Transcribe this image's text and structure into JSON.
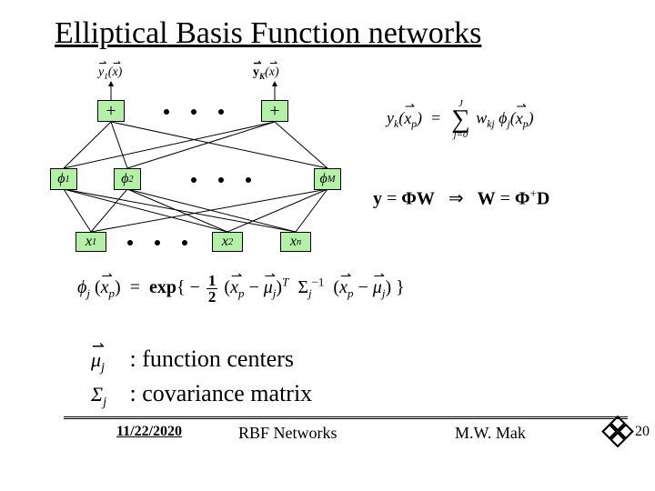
{
  "title": "Elliptical Basis Function networks",
  "outputs": {
    "first_label": "y₁(x⃗)",
    "last_label": "y_K(x⃗)",
    "symbol": "+"
  },
  "hidden": {
    "first": "ϕ₁",
    "second": "ϕ₂",
    "last": "ϕ_M"
  },
  "inputs": {
    "x1": "x₁",
    "x2": "x₂",
    "xn": "xₙ"
  },
  "equations": {
    "yk_lhs": "y_k(x⃗_p) =",
    "sum_upper": "J",
    "sum_lower": "j=0",
    "yk_rhs": "w_{kj} ϕ_j(x⃗_p)",
    "matrix": "y = ΦW   ⇒   W = Φ⁺D",
    "phij": "ϕ_j(x⃗_p) = exp{ −½ (x⃗_p − μ⃗_j)ᵀ Σ_j⁻¹ (x⃗_p − μ⃗_j) }"
  },
  "legend": {
    "mu_sym": "μ⃗_j",
    "mu_text": ": function centers",
    "sigma_sym": "Σ_j",
    "sigma_text": ": covariance matrix"
  },
  "footer": {
    "date": "11/22/2020",
    "center": "RBF Networks",
    "author": "M.W. Mak",
    "page": "20"
  }
}
